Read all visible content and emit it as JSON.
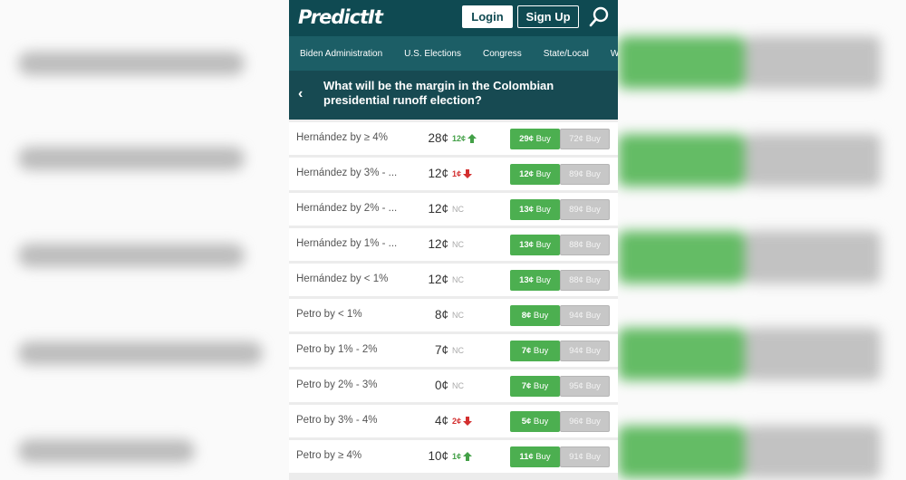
{
  "app": {
    "logo": "PredictIt",
    "login_label": "Login",
    "signup_label": "Sign Up"
  },
  "nav": {
    "items": [
      "Biden Administration",
      "U.S. Elections",
      "Congress",
      "State/Local",
      "World"
    ]
  },
  "market": {
    "question": "What will be the margin in the Colombian presidential runoff election?",
    "buy_label": "Buy"
  },
  "contracts": [
    {
      "name": "Hernández by ≥ 4%",
      "price": "28¢",
      "change": "12¢",
      "dir": "up",
      "yes": "29¢",
      "no": "72¢"
    },
    {
      "name": "Hernández by 3% - ...",
      "price": "12¢",
      "change": "1¢",
      "dir": "down",
      "yes": "12¢",
      "no": "89¢"
    },
    {
      "name": "Hernández by 2% - ...",
      "price": "12¢",
      "change": "NC",
      "dir": "nc",
      "yes": "13¢",
      "no": "89¢"
    },
    {
      "name": "Hernández by 1% - ...",
      "price": "12¢",
      "change": "NC",
      "dir": "nc",
      "yes": "13¢",
      "no": "88¢"
    },
    {
      "name": "Hernández by < 1%",
      "price": "12¢",
      "change": "NC",
      "dir": "nc",
      "yes": "13¢",
      "no": "88¢"
    },
    {
      "name": "Petro by < 1%",
      "price": "8¢",
      "change": "NC",
      "dir": "nc",
      "yes": "8¢",
      "no": "94¢"
    },
    {
      "name": "Petro by 1% - 2%",
      "price": "7¢",
      "change": "NC",
      "dir": "nc",
      "yes": "7¢",
      "no": "94¢"
    },
    {
      "name": "Petro by 2% - 3%",
      "price": "0¢",
      "change": "NC",
      "dir": "nc",
      "yes": "7¢",
      "no": "95¢"
    },
    {
      "name": "Petro by 3% - 4%",
      "price": "4¢",
      "change": "2¢",
      "dir": "down",
      "yes": "5¢",
      "no": "96¢"
    },
    {
      "name": "Petro by ≥ 4%",
      "price": "10¢",
      "change": "1¢",
      "dir": "up",
      "yes": "11¢",
      "no": "91¢"
    }
  ],
  "colors": {
    "brand": "#0f4a52",
    "nav": "#1c5e66",
    "yes_button": "#4caf50",
    "no_button": "#c7c7c7",
    "up": "#43a047",
    "down": "#d32f2f"
  }
}
